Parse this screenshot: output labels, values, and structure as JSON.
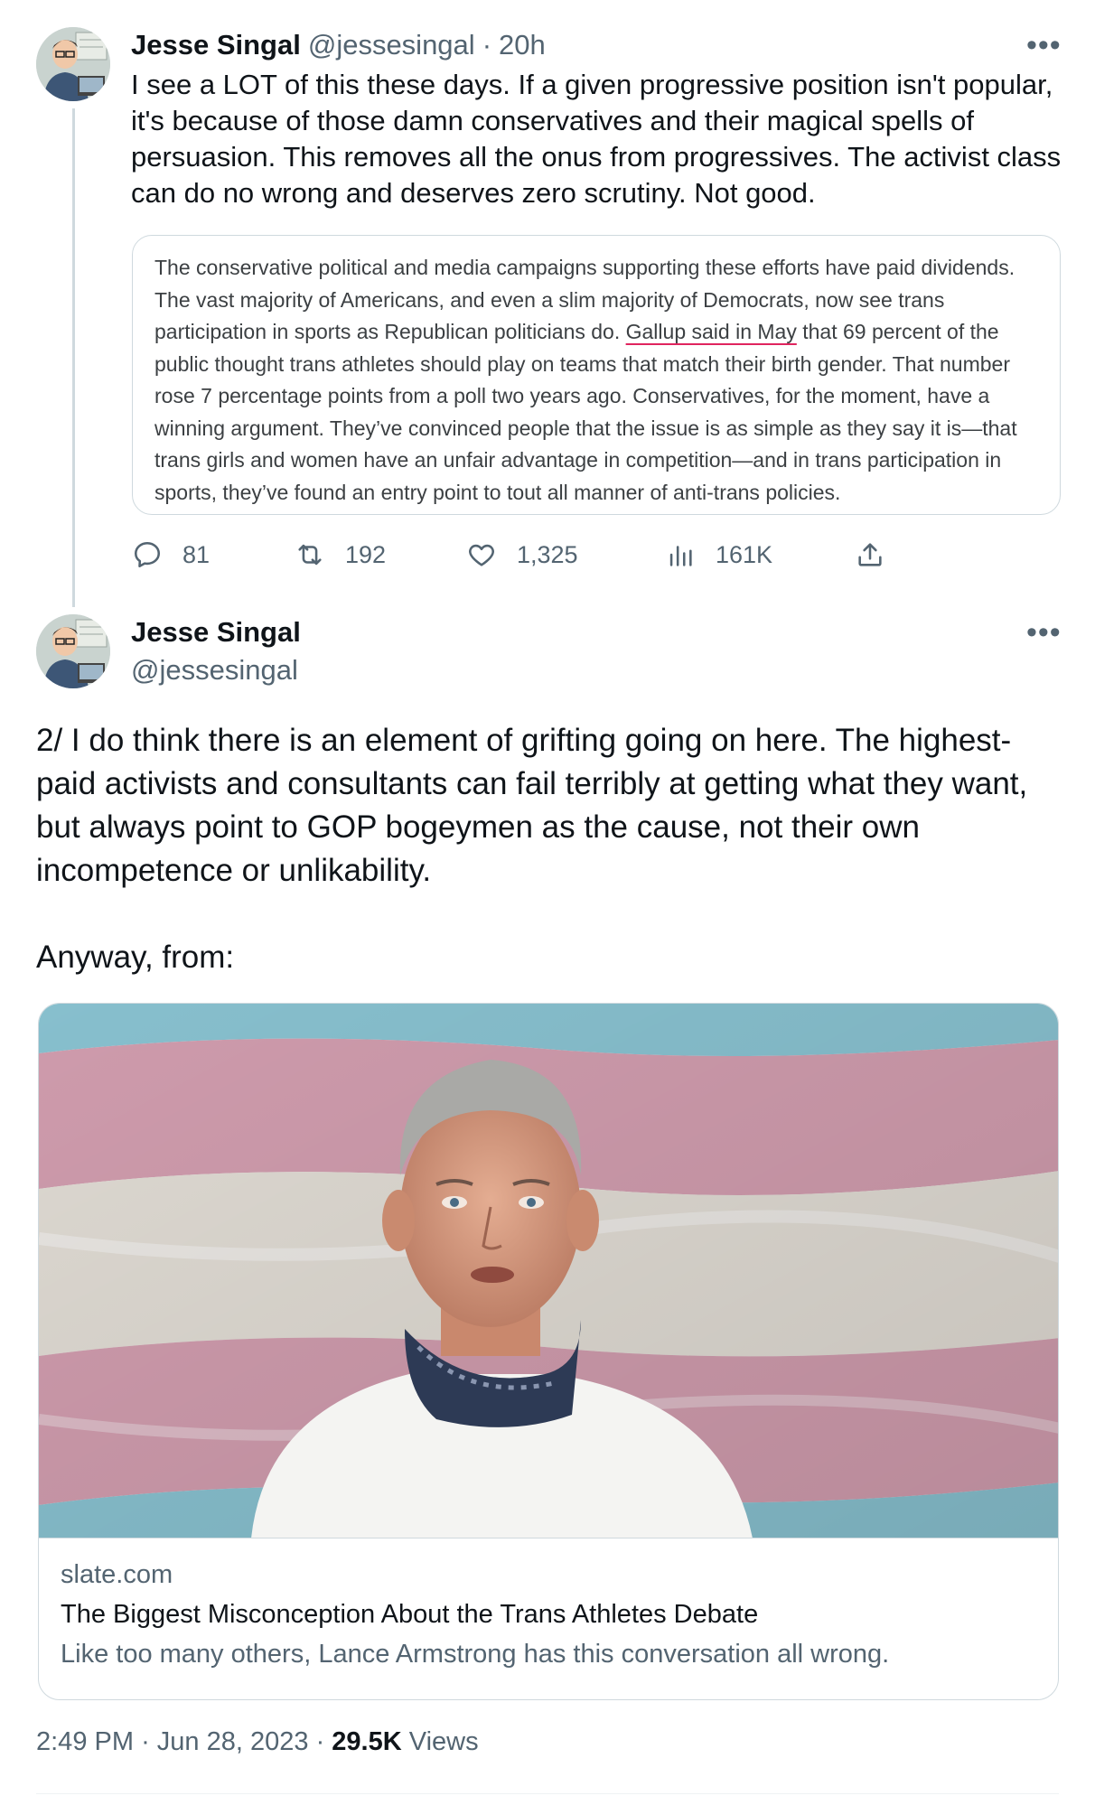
{
  "tweet1": {
    "author_name": "Jesse Singal",
    "author_handle": "@jessesingal",
    "separator": "·",
    "time": "20h",
    "more": "•••",
    "text": "I see a LOT of this these days. If a given progressive position isn't popular, it's because of those damn conservatives and their magical spells of persuasion. This removes all the onus from progressives. The activist class can do no wrong and deserves zero scrutiny. Not good.",
    "quote_image_text": {
      "before": "The conservative political and media campaigns supporting these efforts have paid dividends. The vast majority of Americans, and even a slim majority of Democrats, now see trans participation in sports as Republican politicians do. ",
      "underlined": "Gallup said in May",
      "after": " that 69 percent of the public thought trans athletes should play on teams that match their birth gender. That number rose 7 percentage points from a poll two years ago. Conservatives, for the moment, have a winning argument. They’ve convinced people that the issue is as simple as they say it is—that trans girls and women have an unfair advantage in competition—and in trans participation in sports, they’ve found an entry point to tout all manner of anti-trans policies."
    },
    "actions": {
      "replies": "81",
      "retweets": "192",
      "likes": "1,325",
      "views": "161K"
    }
  },
  "tweet2": {
    "author_name": "Jesse Singal",
    "author_handle": "@jessesingal",
    "more": "•••",
    "text": "2/ I do think there is an element of grifting going on here. The highest-paid activists and consultants can fail terribly at getting what they want, but always point to GOP bogeymen as the cause, not their own incompetence or unlikability.\n\nAnyway, from:",
    "card": {
      "domain": "slate.com",
      "title": "The Biggest Misconception About the Trans Athletes Debate",
      "description": "Like too many others, Lance Armstrong has this conversation all wrong."
    },
    "timestamp": {
      "time": "2:49 PM",
      "separator": "·",
      "date": "Jun 28, 2023",
      "separator2": "·",
      "views_count": "29.5K",
      "views_label": "Views"
    }
  },
  "colors": {
    "text_primary": "#0f1419",
    "text_secondary": "#536471",
    "border": "#cfd9de",
    "flag_blue": "#8ec9d8",
    "flag_pink": "#d9a3b5",
    "flag_white": "#e9e4dc",
    "link_underline": "#e0245e"
  },
  "icons": {
    "reply": "reply-icon",
    "retweet": "retweet-icon",
    "like": "heart-icon",
    "views": "views-icon",
    "share": "share-icon",
    "more": "more-icon"
  }
}
